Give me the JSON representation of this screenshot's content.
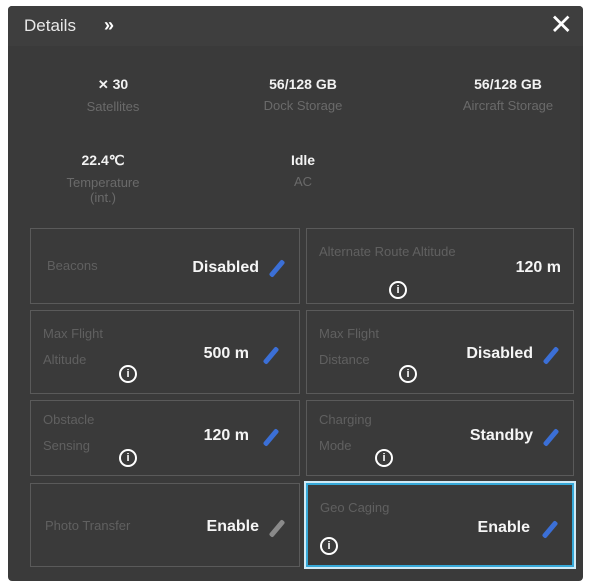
{
  "header": {
    "title": "Details",
    "expand_icon": "»",
    "close_icon": "✕"
  },
  "stats": [
    {
      "icon": "satellite-icon",
      "value": "30",
      "label": "Satellites"
    },
    {
      "value": "56/128 GB",
      "label": "Dock Storage"
    },
    {
      "value": "56/128 GB",
      "label": "Aircraft Storage"
    },
    {
      "value": "22.4℃",
      "label": "Temperature (int.)"
    },
    {
      "value": "Idle",
      "label": "AC"
    }
  ],
  "cards": [
    {
      "label": "Beacons",
      "value": "Disabled"
    },
    {
      "label": "Alternate Route Altitude",
      "value": "120 m"
    },
    {
      "label": "Max Flight Altitude",
      "value": "500 m"
    },
    {
      "label": "Max Flight Distance",
      "value": "Disabled"
    },
    {
      "label": "Obstacle Sensing",
      "value": "120 m"
    },
    {
      "label": "Charging Mode",
      "value": "Standby"
    },
    {
      "label": "Photo Transfer",
      "value": "Enable"
    },
    {
      "label": "Geo Caging",
      "value": "Enable"
    }
  ],
  "colors": {
    "accent": "#3b6fd6",
    "selected_border": "#35a8d8",
    "panel_bg": "#3a3a3a"
  }
}
